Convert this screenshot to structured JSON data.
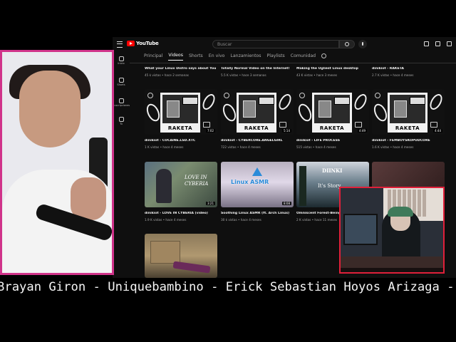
{
  "youtube": {
    "logo_text": "YouTube",
    "search_placeholder": "Buscar",
    "sidebar": [
      "Inicio",
      "Shorts",
      "Suscripciones",
      "Tú"
    ],
    "tabs": [
      {
        "label": "Principal"
      },
      {
        "label": "Videos"
      },
      {
        "label": "Shorts"
      },
      {
        "label": "En vivo"
      },
      {
        "label": "Lanzamientos"
      },
      {
        "label": "Playlists"
      },
      {
        "label": "Comunidad"
      }
    ],
    "top_row": [
      {
        "title": "What your Linux Distro says about You",
        "meta": "45 k vistas • hace 2 semanas"
      },
      {
        "title": "Totally Normal Video on the Internet!",
        "meta": "5.5 K vistas • hace 3 semanas"
      },
      {
        "title": "Making the Ugliest Linux desktop",
        "meta": "43 K vistas • hace 3 meses"
      },
      {
        "title": "dinikiot - RAKETA",
        "meta": "2.7 K vistas • hace 4 meses"
      }
    ],
    "row2": [
      {
        "title": "dinikiot - COCAINE.LSD.XTC",
        "meta": "1 K vistas • hace 4 meses",
        "duration": "7:02",
        "thumb_word": "RAKETA"
      },
      {
        "title": "dinikiot - CYBERCORE.ANGELGIRL",
        "meta": "722 vistas • hace 4 meses",
        "duration": "5:14",
        "thumb_word": "RAKETA"
      },
      {
        "title": "dinikiot - LIFE PROCESS",
        "meta": "515 vistas • hace 4 meses",
        "duration": "4:49",
        "thumb_word": "RAKETA"
      },
      {
        "title": "dinikiot - FEMBOYSKOPUDCORE",
        "meta": "1.6 K vistas • hace 4 meses",
        "duration": "4:44",
        "thumb_word": "RAKETA"
      }
    ],
    "row3": [
      {
        "title": "dinikiot - LOVE IN CYBERIA (video)",
        "meta": "1.9 K vistas • hace 4 meses",
        "duration": "3:21",
        "thumb_text": "LOVE IN CYBERIA"
      },
      {
        "title": "Soothing Linux ASMR (ft. Arch Linux)",
        "meta": "30 k vistas • hace 4 meses",
        "duration": "8:08",
        "thumb_text": "Linux ASMR"
      },
      {
        "title": "Omniscent Forest-Being",
        "meta": "2 K vistas • hace 11 meses",
        "duration": "",
        "thumb_text1": "DIINKI",
        "thumb_text2": "It's Story"
      }
    ]
  },
  "ticker": "Brayan Giron - Uniquebambino - Erick Sebastian Hoyos Arizaga - A"
}
